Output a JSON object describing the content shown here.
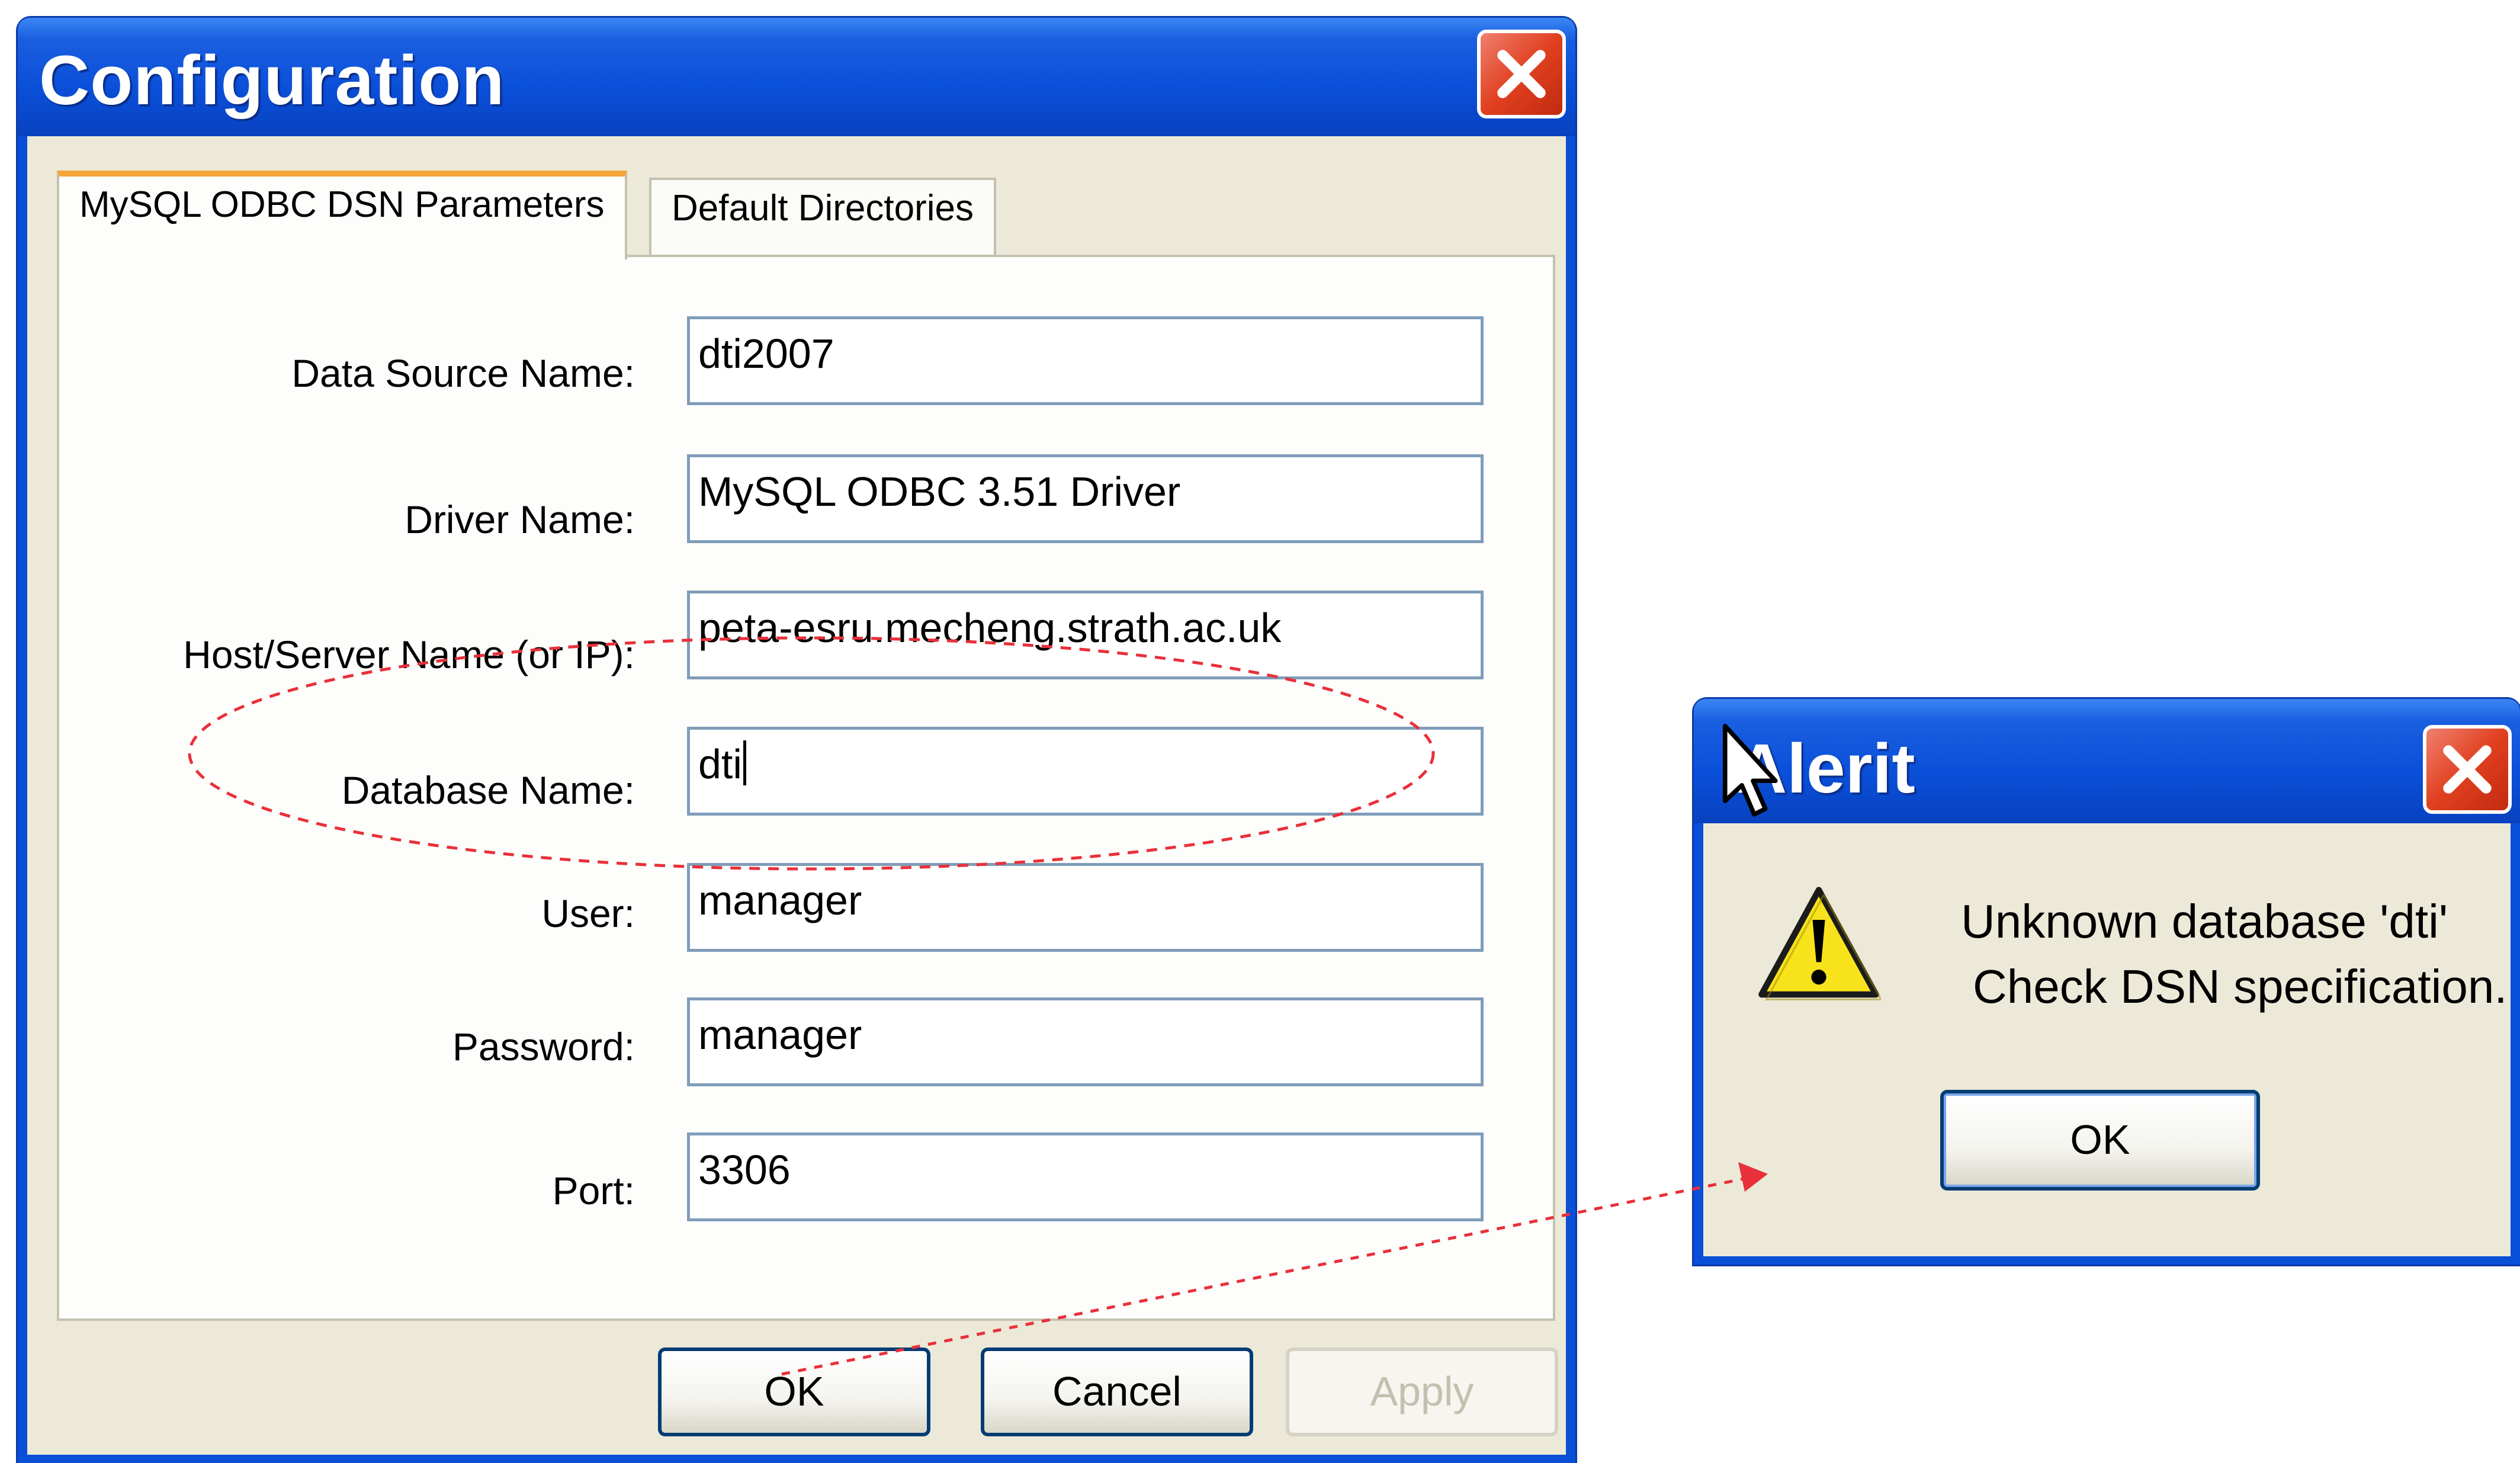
{
  "config_window": {
    "title": "Configuration",
    "tabs": [
      {
        "label": "MySQL ODBC DSN Parameters",
        "active": true
      },
      {
        "label": "Default Directories",
        "active": false
      }
    ],
    "fields": [
      {
        "label": "Data Source Name:",
        "value": "dti2007"
      },
      {
        "label": "Driver Name:",
        "value": "MySQL ODBC 3.51 Driver"
      },
      {
        "label": "Host/Server Name (or IP):",
        "value": "peta-esru.mecheng.strath.ac.uk"
      },
      {
        "label": "Database Name:",
        "value": "dti"
      },
      {
        "label": "User:",
        "value": "manager"
      },
      {
        "label": "Password:",
        "value": "manager"
      },
      {
        "label": "Port:",
        "value": "3306"
      }
    ],
    "buttons": {
      "ok": "OK",
      "cancel": "Cancel",
      "apply": "Apply"
    }
  },
  "alert_window": {
    "title": "Alerit",
    "message_line1": "Unknown database 'dti'",
    "message_line2": "Check DSN specification.",
    "ok": "OK",
    "icon": "warning-icon"
  },
  "colors": {
    "titlebar": "#0a4fd8",
    "close_button": "#e0401f",
    "tab_highlight": "#f5a53a",
    "annotation": "#e8303a"
  }
}
